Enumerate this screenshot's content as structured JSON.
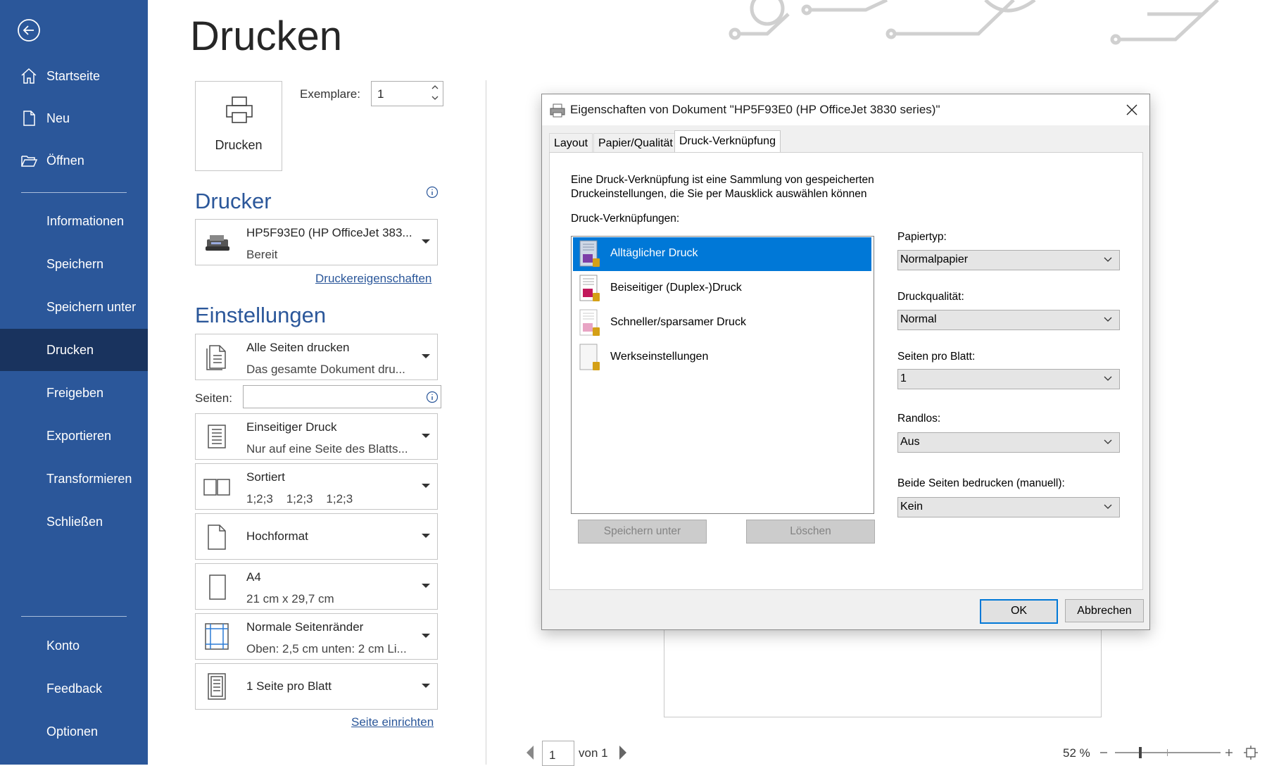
{
  "sidebar": {
    "back_icon": "back-arrow-icon",
    "items_top": [
      {
        "label": "Startseite",
        "icon": "home-icon"
      },
      {
        "label": "Neu",
        "icon": "new-doc-icon"
      },
      {
        "label": "Öffnen",
        "icon": "folder-open-icon"
      }
    ],
    "items_mid": [
      "Informationen",
      "Speichern",
      "Speichern unter",
      "Drucken",
      "Freigeben",
      "Exportieren",
      "Transformieren",
      "Schließen"
    ],
    "active": "Drucken",
    "items_bottom": [
      "Konto",
      "Feedback",
      "Optionen"
    ],
    "bg_color": "#2b579a",
    "active_color": "#19335e"
  },
  "print": {
    "title": "Drucken",
    "print_button_label": "Drucken",
    "copies_label": "Exemplare:",
    "copies_value": "1"
  },
  "printer": {
    "heading": "Drucker",
    "name": "HP5F93E0 (HP OfficeJet 383...",
    "status": "Bereit",
    "properties_link": "Druckereigenschaften"
  },
  "settings": {
    "heading": "Einstellungen",
    "pages_label": "Seiten:",
    "pages_value": "",
    "rows": [
      {
        "l1": "Alle Seiten drucken",
        "l2": "Das gesamte Dokument dru..."
      },
      {
        "l1": "Einseitiger Druck",
        "l2": "Nur auf eine Seite des Blatts..."
      },
      {
        "l1": "Sortiert",
        "l2": "1;2;3    1;2;3    1;2;3"
      },
      {
        "l1": "Hochformat",
        "l2": ""
      },
      {
        "l1": "A4",
        "l2": "21 cm x 29,7 cm"
      },
      {
        "l1": "Normale Seitenränder",
        "l2": "Oben: 2,5 cm unten: 2 cm Li..."
      },
      {
        "l1": "1 Seite pro Blatt",
        "l2": ""
      }
    ],
    "page_setup_link": "Seite einrichten"
  },
  "dialog": {
    "title": "Eigenschaften von Dokument \"HP5F93E0 (HP OfficeJet 3830 series)\"",
    "tabs": [
      "Layout",
      "Papier/Qualität",
      "Druck-Verknüpfung"
    ],
    "active_tab": "Druck-Verknüpfung",
    "description_line1": "Eine Druck-Verknüpfung ist eine Sammlung von gespeicherten",
    "description_line2": "Druckeinstellungen, die Sie per Mausklick auswählen können",
    "shortcuts_label": "Druck-Verknüpfungen:",
    "shortcuts": [
      "Alltäglicher Druck",
      "Beiseitiger (Duplex-)Druck",
      "Schneller/sparsamer Druck",
      "Werkseinstellungen"
    ],
    "selected_shortcut": "Alltäglicher Druck",
    "save_as_button": "Speichern unter",
    "delete_button": "Löschen",
    "fields": [
      {
        "label": "Papiertyp:",
        "value": "Normalpapier"
      },
      {
        "label": "Druckqualität:",
        "value": "Normal"
      },
      {
        "label": "Seiten pro Blatt:",
        "value": "1"
      },
      {
        "label": "Randlos:",
        "value": "Aus"
      },
      {
        "label": "Beide Seiten bedrucken (manuell):",
        "value": "Kein"
      }
    ],
    "ok_button": "OK",
    "cancel_button": "Abbrechen"
  },
  "footer": {
    "page_value": "1",
    "of_text": "von 1",
    "zoom": "52 %"
  }
}
